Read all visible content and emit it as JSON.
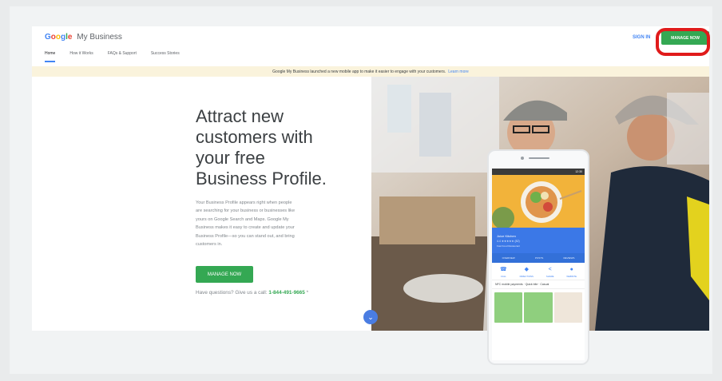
{
  "header": {
    "logo_google": "Google",
    "logo_rest": "My Business",
    "tabs": [
      {
        "label": "Home",
        "active": true
      },
      {
        "label": "How it Works",
        "active": false
      },
      {
        "label": "FAQs & Support",
        "active": false
      },
      {
        "label": "Success Stories",
        "active": false
      }
    ],
    "signin_label": "SIGN IN",
    "manage_label": "MANAGE NOW"
  },
  "banner": {
    "text": "Google My Business launched a new mobile app to make it easier to engage with your customers.",
    "link": "Learn more"
  },
  "hero": {
    "title_lines": [
      "Attract new",
      "customers with",
      "your free",
      "Business Profile."
    ],
    "description_lines": [
      "Your Business Profile appears right when people",
      "are searching for your business or businesses like",
      "yours on Google Search and Maps. Google My",
      "Business makes it easy to create and update your",
      "Business Profile—so you can stand out, and bring",
      "customers in."
    ],
    "cta_label": "MANAGE NOW",
    "call_prefix": "Have questions? Give us a call:",
    "call_number": "1-844-491-9665",
    "call_suffix": " *"
  },
  "phone": {
    "status_time": "12:30",
    "listing_name": "Juice Kitchen",
    "listing_rating": "4.4 ★★★★★ (82)",
    "listing_category": "Fast Food Restaurant",
    "listing_tabs": [
      "OVERVIEW",
      "POSTS",
      "REVIEWS"
    ],
    "actions": [
      {
        "label": "CALL",
        "icon": "☎"
      },
      {
        "label": "DIRECTIONS",
        "icon": "◆"
      },
      {
        "label": "SHARE",
        "icon": "<"
      },
      {
        "label": "WEBSITE",
        "icon": "●"
      }
    ],
    "info_line": "NFC mobile payments · Quick bite · Casual"
  },
  "scroll_icon": "⌄",
  "colors": {
    "brand_blue": "#4285f4",
    "brand_green": "#34a853",
    "highlight_red": "#e01b1b",
    "banner_bg": "#faf3dc"
  }
}
